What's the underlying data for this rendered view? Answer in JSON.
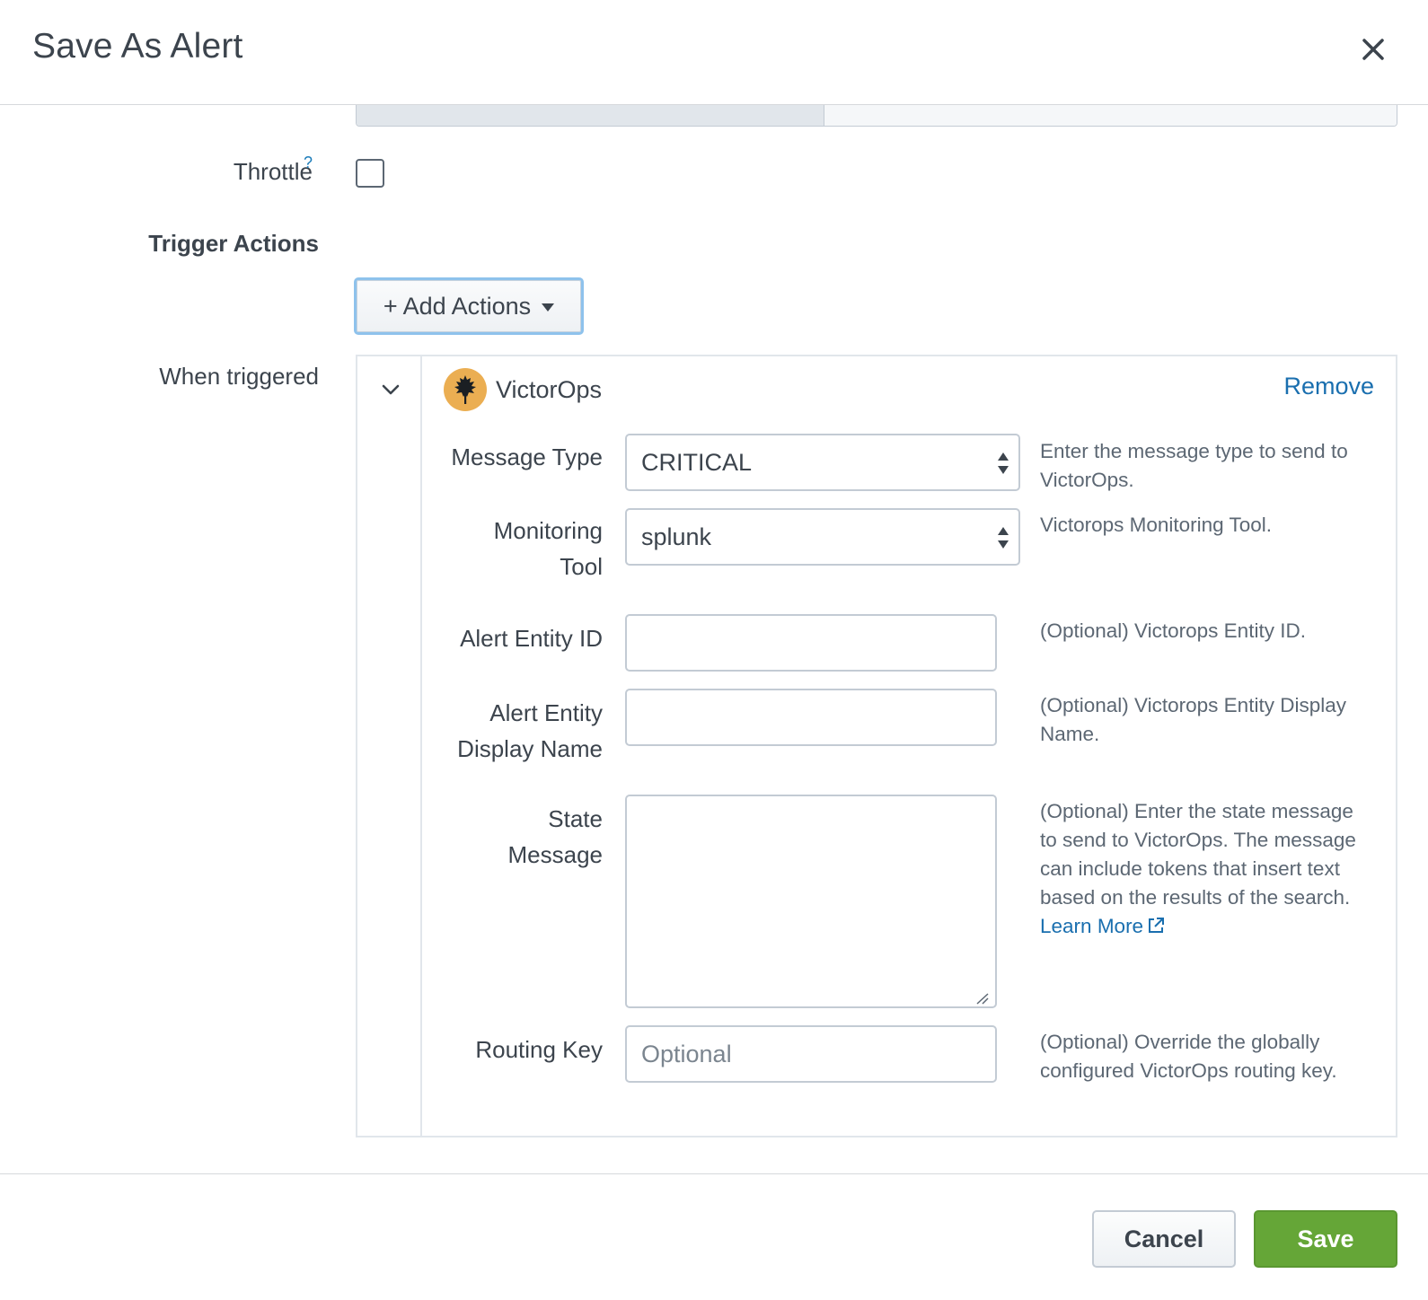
{
  "dialog": {
    "title": "Save As Alert",
    "close_icon": "close-icon"
  },
  "form": {
    "throttle": {
      "label": "Throttle",
      "help": "?",
      "checked": false
    },
    "trigger_actions": {
      "title": "Trigger Actions",
      "add_actions_label": "+ Add Actions"
    },
    "when_triggered_label": "When triggered"
  },
  "action": {
    "name": "VictorOps",
    "icon": "victorops-leaf-icon",
    "logo_color": "#ebae52",
    "remove_label": "Remove",
    "fields": {
      "message_type": {
        "label": "Message Type",
        "value": "CRITICAL",
        "help": "Enter the message type to send to VictorOps."
      },
      "monitoring_tool": {
        "label_line1": "Monitoring",
        "label_line2": "Tool",
        "value": "splunk",
        "help": "Victorops Monitoring Tool."
      },
      "alert_entity_id": {
        "label": "Alert Entity ID",
        "value": "",
        "help": "(Optional) Victorops Entity ID."
      },
      "alert_entity_display_name": {
        "label_line1": "Alert Entity",
        "label_line2": "Display Name",
        "value": "",
        "help": "(Optional) Victorops Entity Display Name."
      },
      "state_message": {
        "label_line1": "State",
        "label_line2": "Message",
        "value": "",
        "help": "(Optional) Enter the state message to send to VictorOps. The message can include tokens that insert text based on the results of the search.",
        "link_line1": "Learn",
        "link_line2": "More"
      },
      "routing_key": {
        "label": "Routing Key",
        "value": "",
        "placeholder": "Optional",
        "help": "(Optional) Override the globally configured VictorOps routing key."
      }
    }
  },
  "footer": {
    "cancel_label": "Cancel",
    "save_label": "Save",
    "save_color": "#65a637"
  }
}
